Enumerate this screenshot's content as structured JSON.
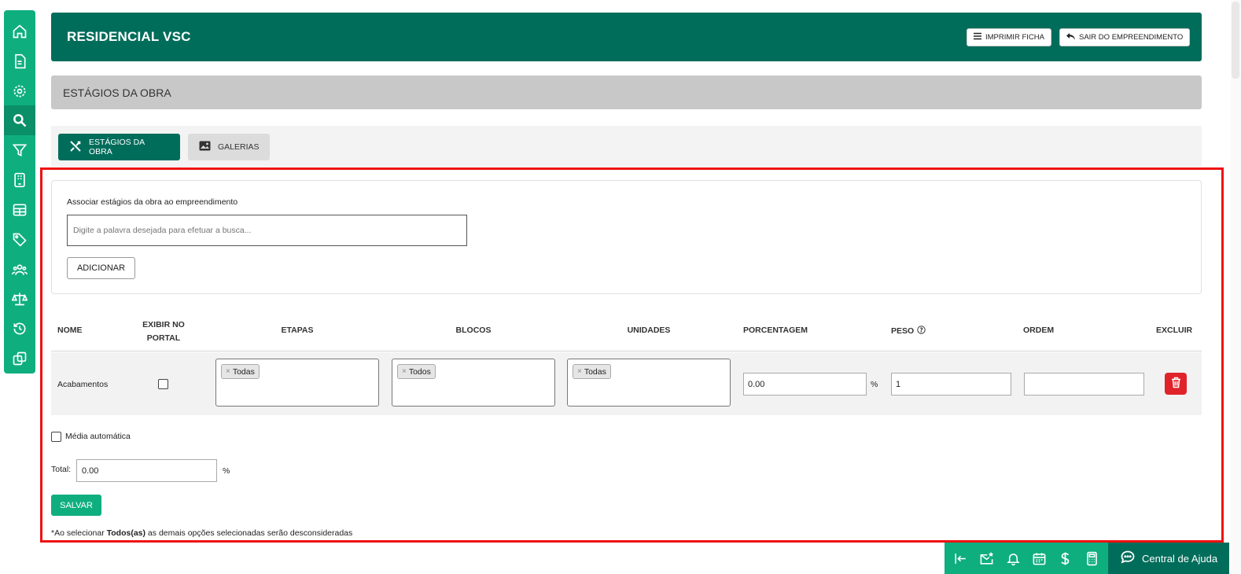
{
  "sidebar": {
    "icons": [
      "home-icon",
      "document-icon",
      "settings-icon",
      "search-icon",
      "filter-icon",
      "building-icon",
      "table-icon",
      "tag-icon",
      "users-icon",
      "scale-icon",
      "history-icon",
      "copy-icon"
    ],
    "active_index": 3
  },
  "header": {
    "title": "RESIDENCIAL VSC",
    "print_label": "IMPRIMIR FICHA",
    "exit_label": "SAIR DO EMPREENDIMENTO"
  },
  "section": {
    "title": "ESTÁGIOS DA OBRA"
  },
  "tabs": [
    {
      "label": "ESTÁGIOS DA OBRA",
      "icon": "tools-icon",
      "active": true
    },
    {
      "label": "GALERIAS",
      "icon": "image-icon",
      "active": false
    }
  ],
  "associate": {
    "label": "Associar estágios da obra ao empreendimento",
    "placeholder": "Digite a palavra desejada para efetuar a busca...",
    "add_label": "ADICIONAR"
  },
  "table": {
    "headers": {
      "nome": "NOME",
      "exibir_line1": "EXIBIR NO",
      "exibir_line2": "PORTAL",
      "etapas": "ETAPAS",
      "blocos": "BLOCOS",
      "unidades": "UNIDADES",
      "porcentagem": "PORCENTAGEM",
      "peso": "PESO",
      "ordem": "ORDEM",
      "excluir": "EXCLUIR"
    },
    "row": {
      "nome": "Acabamentos",
      "exibir_checked": false,
      "etapas": "Todas",
      "blocos": "Todos",
      "unidades": "Todas",
      "porcentagem": "0.00",
      "percent_sign": "%",
      "peso": "1",
      "ordem": ""
    }
  },
  "auto_average_label": "Média automática",
  "total": {
    "label": "Total:",
    "value": "0.00",
    "unit": "%"
  },
  "save_label": "SALVAR",
  "note": {
    "prefix": "*Ao selecionar ",
    "bold": "Todos(as)",
    "suffix": " as demais opções selecionadas serão desconsideradas"
  },
  "bottom_bar": {
    "icons": [
      "collapse-left-icon",
      "mail-star-icon",
      "bell-icon",
      "calendar-icon",
      "dollar-icon",
      "calculator-icon"
    ],
    "help_label": "Central de Ajuda"
  },
  "colors": {
    "primary_dark": "#006d5b",
    "primary": "#0fae7f",
    "danger": "#e0232a",
    "highlight": "#ee1111"
  }
}
